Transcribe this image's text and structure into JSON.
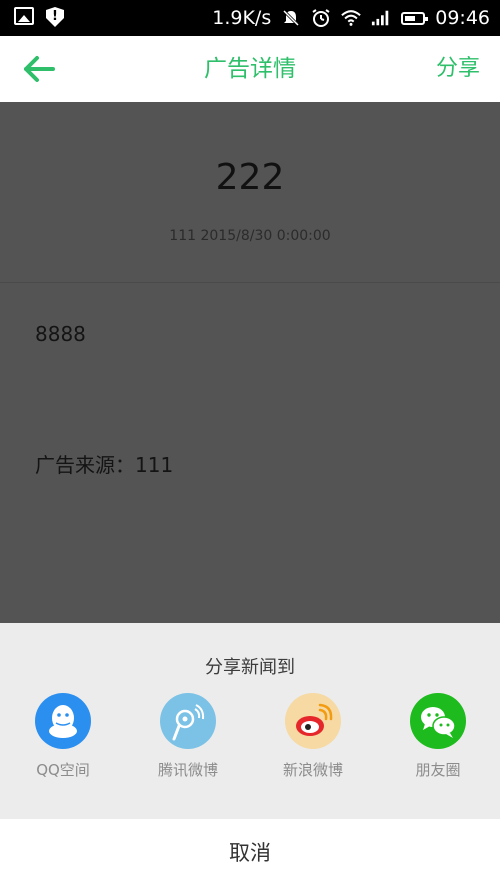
{
  "status_bar": {
    "network_speed": "1.9K/s",
    "time": "09:46",
    "left_icons": [
      "image-icon",
      "shield-icon"
    ],
    "right_icons": [
      "mute-icon",
      "alarm-icon",
      "wifi-icon",
      "signal-icon",
      "battery-icon"
    ]
  },
  "header": {
    "back_icon": "arrow-left-icon",
    "title": "广告详情",
    "share_label": "分享",
    "accent_color": "#2fbf6a"
  },
  "article": {
    "title": "222",
    "meta": "111 2015/8/30 0:00:00",
    "body": "8888",
    "source": "广告来源：111"
  },
  "share_sheet": {
    "title": "分享新闻到",
    "targets": [
      {
        "label": "QQ空间",
        "icon": "qzone-icon",
        "color": "#2b8ff0"
      },
      {
        "label": "腾讯微博",
        "icon": "tencent-weibo-icon",
        "color": "#7cc2e6"
      },
      {
        "label": "新浪微博",
        "icon": "sina-weibo-icon",
        "color": "#f6d9a3"
      },
      {
        "label": "朋友圈",
        "icon": "wechat-moments-icon",
        "color": "#1dbb1d"
      }
    ],
    "cancel_label": "取消"
  }
}
